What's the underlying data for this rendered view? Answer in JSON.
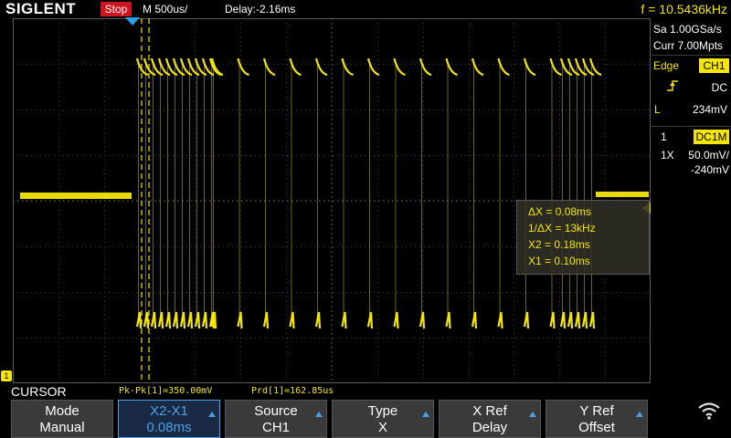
{
  "header": {
    "brand": "SIGLENT",
    "run_state": "Stop",
    "timebase": "M 500us/",
    "delay": "Delay:-2.16ms",
    "frequency": "f = 10.5436kHz"
  },
  "acquisition": {
    "sample_rate": "Sa 1.00GSa/s",
    "memory_depth": "Curr 7.00Mpts"
  },
  "trigger": {
    "type": "Edge",
    "source": "CH1",
    "coupling": "DC",
    "level_label": "L",
    "level": "234mV"
  },
  "channel": {
    "number": "1",
    "coupling_badge": "DC1M",
    "probe": "1X",
    "scale": "50.0mV/",
    "offset": "-240mV"
  },
  "cursor_readout": {
    "delta_x": "ΔX = 0.08ms",
    "inv_delta_x": "1/ΔX = 13kHz",
    "x2": "X2 = 0.18ms",
    "x1": "X1 = 0.10ms"
  },
  "footer": {
    "menu_title": "CURSOR",
    "measure_pkpk": "Pk-Pk[1]=350.00mV",
    "measure_prd": "Prd[1]=162.85us"
  },
  "softkeys": [
    {
      "line1": "Mode",
      "line2": "Manual",
      "arrow": false,
      "selected": false
    },
    {
      "line1": "X2-X1",
      "line2": "0.08ms",
      "arrow": true,
      "selected": true
    },
    {
      "line1": "Source",
      "line2": "CH1",
      "arrow": true,
      "selected": false
    },
    {
      "line1": "Type",
      "line2": "X",
      "arrow": true,
      "selected": false
    },
    {
      "line1": "X Ref",
      "line2": "Delay",
      "arrow": true,
      "selected": false
    },
    {
      "line1": "Y Ref",
      "line2": "Offset",
      "arrow": true,
      "selected": false
    }
  ],
  "colors": {
    "ch1": "#f4e600",
    "stop": "#d0141d",
    "grid": "#3a3a3a",
    "selected": "#4aa0e8"
  },
  "icons": [
    "trigger-position-icon",
    "trigger-level-marker-icon",
    "rising-edge-icon",
    "ground-marker-icon",
    "wifi-icon"
  ]
}
